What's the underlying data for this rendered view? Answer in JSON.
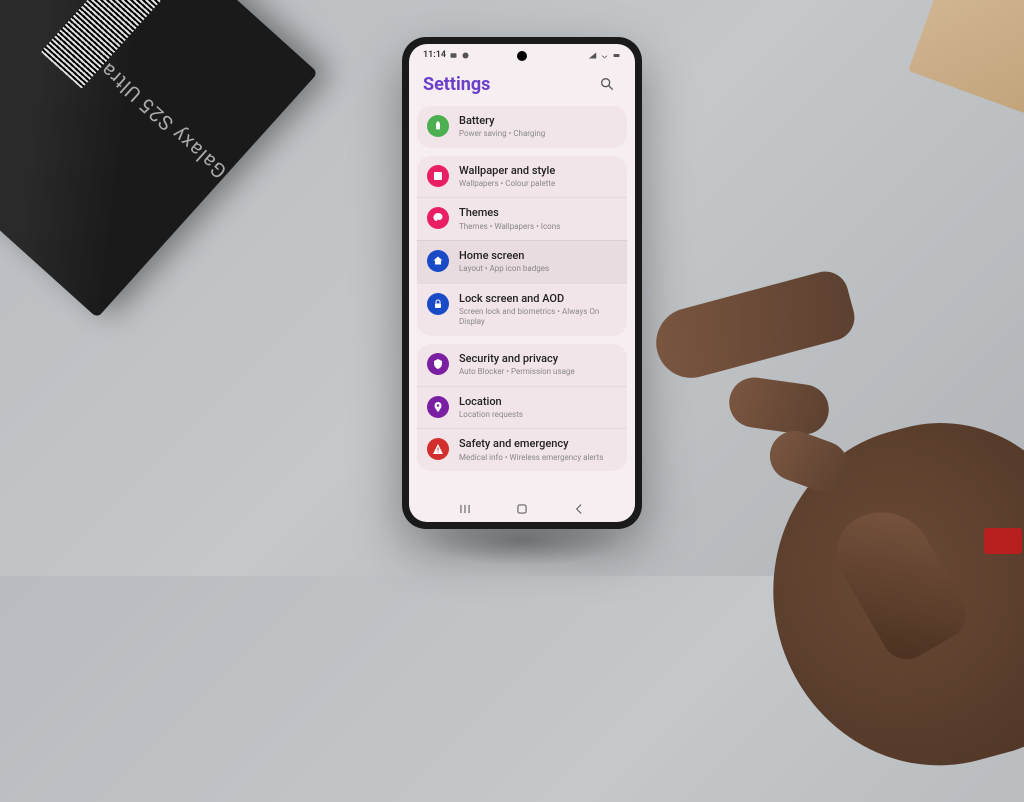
{
  "product": {
    "name": "Galaxy S25 Ultra"
  },
  "status": {
    "time": "11:14"
  },
  "header": {
    "title": "Settings"
  },
  "groups": [
    {
      "items": [
        {
          "icon": "battery",
          "color": "#4caf50",
          "title": "Battery",
          "subtitle": "Power saving • Charging"
        }
      ]
    },
    {
      "items": [
        {
          "icon": "wallpaper",
          "color": "#e91e63",
          "title": "Wallpaper and style",
          "subtitle": "Wallpapers • Colour palette"
        },
        {
          "icon": "themes",
          "color": "#e91e63",
          "title": "Themes",
          "subtitle": "Themes • Wallpapers • Icons"
        },
        {
          "icon": "home",
          "color": "#1a4bc7",
          "title": "Home screen",
          "subtitle": "Layout • App icon badges",
          "highlighted": true
        },
        {
          "icon": "lock",
          "color": "#1a4bc7",
          "title": "Lock screen and AOD",
          "subtitle": "Screen lock and biometrics • Always On Display"
        }
      ]
    },
    {
      "items": [
        {
          "icon": "security",
          "color": "#7b1fa2",
          "title": "Security and privacy",
          "subtitle": "Auto Blocker • Permission usage"
        },
        {
          "icon": "location",
          "color": "#7b1fa2",
          "title": "Location",
          "subtitle": "Location requests"
        },
        {
          "icon": "emergency",
          "color": "#d32f2f",
          "title": "Safety and emergency",
          "subtitle": "Medical info • Wireless emergency alerts"
        }
      ]
    }
  ]
}
